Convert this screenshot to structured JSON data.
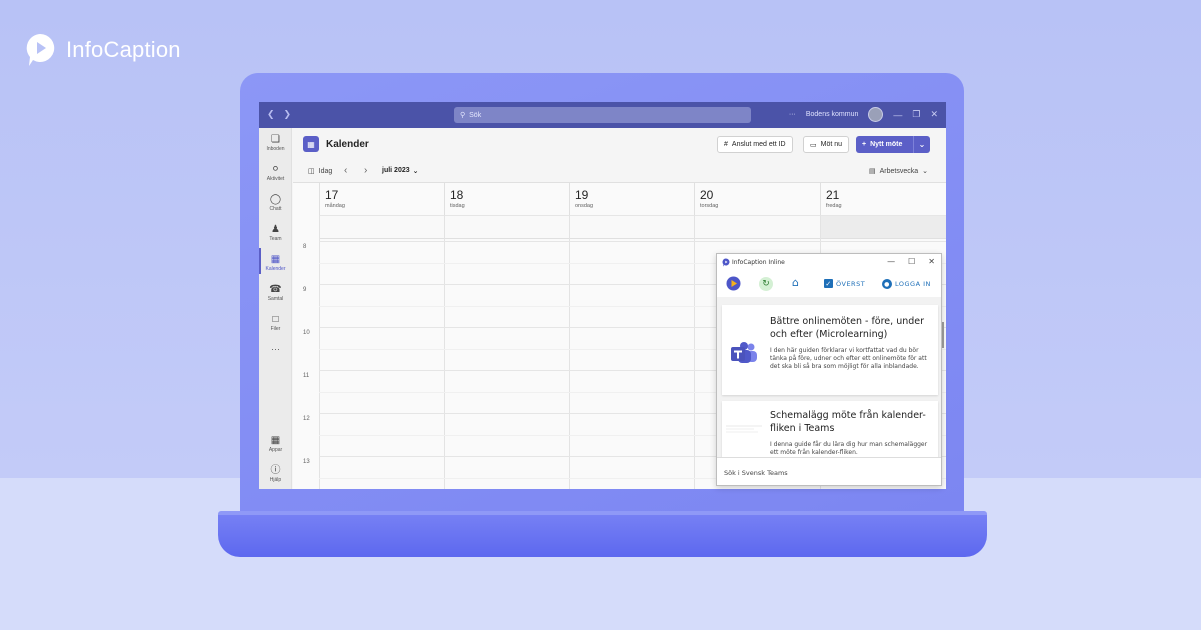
{
  "brand": {
    "name": "InfoCaption"
  },
  "teams": {
    "search_placeholder": "Sök",
    "org_name": "Bodens kommun",
    "rail": [
      {
        "label": "Inboden",
        "icon": "activity-feed-icon"
      },
      {
        "label": "Aktivitet",
        "icon": "bell-icon"
      },
      {
        "label": "Chatt",
        "icon": "chat-icon"
      },
      {
        "label": "Team",
        "icon": "team-icon"
      },
      {
        "label": "Kalender",
        "icon": "calendar-icon"
      },
      {
        "label": "Samtal",
        "icon": "phone-icon"
      },
      {
        "label": "Filer",
        "icon": "file-icon"
      },
      {
        "label": "Appar",
        "icon": "apps-icon"
      },
      {
        "label": "Hjälp",
        "icon": "help-icon"
      }
    ],
    "calendar": {
      "title": "Kalender",
      "join_with_id": "Anslut med ett ID",
      "meet_now": "Möt nu",
      "new_meeting": "Nytt möte",
      "today": "Idag",
      "month": "juli 2023",
      "view": "Arbetsvecka",
      "days": [
        {
          "num": "17",
          "name": "måndag"
        },
        {
          "num": "18",
          "name": "tisdag"
        },
        {
          "num": "19",
          "name": "onsdag"
        },
        {
          "num": "20",
          "name": "torsdag"
        },
        {
          "num": "21",
          "name": "fredag"
        }
      ],
      "hours": [
        "8",
        "9",
        "10",
        "11",
        "12",
        "13"
      ]
    }
  },
  "infocaption": {
    "window_title": "InfoCaption Inline",
    "top_label": "ÖVERST",
    "login_label": "LOGGA IN",
    "cards": [
      {
        "title": "Bättre onlinemöten - före, under och efter (Microlearning)",
        "desc": "I den här guiden förklarar vi kortfattat vad du bör tänka på före, udner och efter ett onlinemöte för att det ska bli så bra som möjligt för alla inblandade."
      },
      {
        "title": "Schemalägg möte från kalender-fliken i Teams",
        "desc": "I denna guide får du lära dig hur man schemalägger ett möte från kalender-fliken."
      }
    ],
    "search_label": "Sök i Svensk Teams"
  },
  "colors": {
    "brand_purple": "#5b5fc7",
    "titlebar": "#4b53a8",
    "ic_blue": "#1e6fb8"
  }
}
